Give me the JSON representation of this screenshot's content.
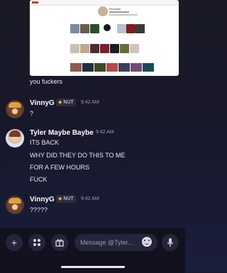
{
  "preview": {
    "profile_name": "Pinwheel"
  },
  "messages": [
    {
      "author": "",
      "text": "you fuckers"
    },
    {
      "author": "VinnyG",
      "badge": "NUT",
      "time": "9:42 AM",
      "lines": [
        "?"
      ]
    },
    {
      "author": "Tyler Maybe Baybe",
      "time": "9:42 AM",
      "lines": [
        "ITS BACK",
        "WHY DID THEY DO THIS TO ME",
        "FOR A FEW HOURS",
        "FUCK"
      ]
    },
    {
      "author": "VinnyG",
      "badge": "NUT",
      "time": "9:42 AM",
      "lines": [
        "?????"
      ]
    }
  ],
  "composer": {
    "placeholder": "Message @Tyler..."
  },
  "icons": {
    "add": "plus-icon",
    "apps": "apps-icon",
    "gift": "gift-icon",
    "emoji": "emoji-icon",
    "mic": "microphone-icon",
    "badge": "flame-icon"
  },
  "colors": {
    "background": "#1a1a26",
    "composer": "#24253a",
    "badge_flame": "#f0a33a"
  }
}
